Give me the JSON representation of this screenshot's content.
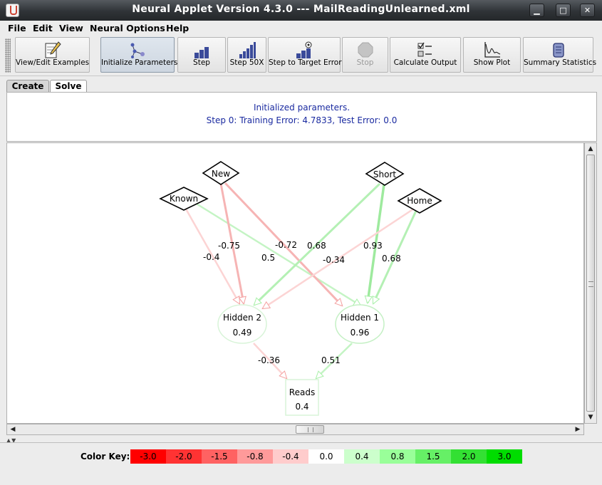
{
  "window": {
    "title": "Neural Applet Version 4.3.0 --- MailReadingUnlearned.xml",
    "minimize_glyph": "▁",
    "maximize_glyph": "□",
    "close_glyph": "✕"
  },
  "menu": [
    "File",
    "Edit",
    "View",
    "Neural Options",
    "Help"
  ],
  "toolbar": {
    "view_edit": "View/Edit Examples",
    "init": "Initialize Parameters",
    "step": "Step",
    "step50": "Step 50X",
    "step_target": "Step to Target Error",
    "stop": "Stop",
    "calc": "Calculate Output",
    "plot": "Show Plot",
    "summary": "Summary Statistics"
  },
  "tabs": {
    "create": "Create",
    "solve": "Solve"
  },
  "status": {
    "line1": "Initialized parameters.",
    "line2": "Step 0: Training Error: 4.7833, Test Error: 0.0"
  },
  "network": {
    "inputs": {
      "known": "Known",
      "new": "New",
      "short": "Short",
      "home": "Home"
    },
    "hidden2": {
      "name": "Hidden 2",
      "value": "0.49"
    },
    "hidden1": {
      "name": "Hidden 1",
      "value": "0.96"
    },
    "output": {
      "name": "Reads",
      "value": "0.4"
    },
    "weights": {
      "known_h2": "-0.4",
      "known_h1": "0.5",
      "new_h2": "-0.75",
      "new_h1": "-0.72",
      "short_h2": "0.68",
      "short_h1": "0.93",
      "home_h2": "-0.34",
      "home_h1": "0.68",
      "h2_out": "-0.36",
      "h1_out": "0.51"
    },
    "colors": {
      "negative": "#f4a0a0",
      "positive": "#a8f0a8"
    }
  },
  "scroll": {
    "up": "▲",
    "down": "▼",
    "left": "◀",
    "right": "▶",
    "split": "▲▼"
  },
  "color_key": {
    "label": "Color Key:",
    "items": [
      {
        "text": "-3.0",
        "color": "#ff0000"
      },
      {
        "text": "-2.0",
        "color": "#ff3333"
      },
      {
        "text": "-1.5",
        "color": "#ff6262"
      },
      {
        "text": "-0.8",
        "color": "#ff9a9a"
      },
      {
        "text": "-0.4",
        "color": "#ffcccc"
      },
      {
        "text": "0.0",
        "color": "#ffffff"
      },
      {
        "text": "0.4",
        "color": "#ccffcc"
      },
      {
        "text": "0.8",
        "color": "#99ff99"
      },
      {
        "text": "1.5",
        "color": "#66f066"
      },
      {
        "text": "2.0",
        "color": "#33e033"
      },
      {
        "text": "3.0",
        "color": "#00dd00"
      }
    ]
  }
}
